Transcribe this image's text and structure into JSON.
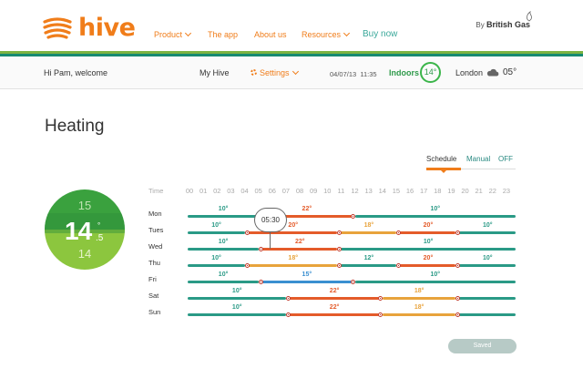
{
  "nav": {
    "brand": "hive",
    "links": [
      {
        "label": "Product",
        "has_caret": true
      },
      {
        "label": "The app",
        "has_caret": false
      },
      {
        "label": "About us",
        "has_caret": false
      },
      {
        "label": "Resources",
        "has_caret": true
      },
      {
        "label": "Buy now",
        "has_caret": false
      }
    ],
    "partner_prefix": "By",
    "partner": "British Gas"
  },
  "status": {
    "welcome": "Hi Pam, welcome",
    "my_hive": "My Hive",
    "settings": "Settings",
    "date": "04/07/13",
    "time": "11:35",
    "indoors_label": "Indoors",
    "indoors_temp": "14°",
    "city": "London",
    "outdoor_temp": "05°"
  },
  "page": {
    "title": "Heating"
  },
  "modes": {
    "schedule": "Schedule",
    "manual": "Manual",
    "off": "OFF",
    "active": "Schedule"
  },
  "dial": {
    "current": "14",
    "decimal": ".5",
    "degree": "°",
    "up": "15",
    "down": "14"
  },
  "schedule": {
    "time_label": "Time",
    "hours": [
      "00",
      "01",
      "02",
      "03",
      "04",
      "05",
      "06",
      "07",
      "08",
      "09",
      "10",
      "11",
      "12",
      "13",
      "14",
      "15",
      "16",
      "17",
      "18",
      "19",
      "20",
      "21",
      "22",
      "23"
    ],
    "selected_time": "05:30",
    "save_label": "Saved",
    "colors": {
      "cold": "#2a9a86",
      "warm": "#e8a33c",
      "hot": "#e45b2a",
      "cool": "#3a8fd0"
    },
    "days": [
      {
        "name": "Mon",
        "segments": [
          {
            "from": 0,
            "to": 5.5,
            "temp": "10°",
            "level": "cold"
          },
          {
            "from": 5.5,
            "to": 12.2,
            "temp": "22°",
            "level": "hot"
          },
          {
            "from": 12.2,
            "to": 24,
            "temp": "10°",
            "level": "cold"
          }
        ]
      },
      {
        "name": "Tues",
        "segments": [
          {
            "from": 0,
            "to": 4.5,
            "temp": "10°",
            "level": "cold"
          },
          {
            "from": 4.5,
            "to": 11.2,
            "temp": "20°",
            "level": "hot"
          },
          {
            "from": 11.2,
            "to": 15.5,
            "temp": "18°",
            "level": "warm"
          },
          {
            "from": 15.5,
            "to": 19.8,
            "temp": "20°",
            "level": "hot"
          },
          {
            "from": 19.8,
            "to": 24,
            "temp": "10°",
            "level": "cold"
          }
        ]
      },
      {
        "name": "Wed",
        "segments": [
          {
            "from": 0,
            "to": 5.5,
            "temp": "10°",
            "level": "cold"
          },
          {
            "from": 5.5,
            "to": 11.2,
            "temp": "22°",
            "level": "hot"
          },
          {
            "from": 11.2,
            "to": 24,
            "temp": "10°",
            "level": "cold"
          }
        ]
      },
      {
        "name": "Thu",
        "segments": [
          {
            "from": 0,
            "to": 4.5,
            "temp": "10°",
            "level": "cold"
          },
          {
            "from": 4.5,
            "to": 11.2,
            "temp": "18°",
            "level": "warm"
          },
          {
            "from": 11.2,
            "to": 15.5,
            "temp": "12°",
            "level": "cold"
          },
          {
            "from": 15.5,
            "to": 19.8,
            "temp": "20°",
            "level": "hot"
          },
          {
            "from": 19.8,
            "to": 24,
            "temp": "10°",
            "level": "cold"
          }
        ]
      },
      {
        "name": "Fri",
        "segments": [
          {
            "from": 0,
            "to": 5.5,
            "temp": "10°",
            "level": "cold"
          },
          {
            "from": 5.5,
            "to": 12.2,
            "temp": "15°",
            "level": "cool"
          },
          {
            "from": 12.2,
            "to": 24,
            "temp": "10°",
            "level": "cold"
          }
        ]
      },
      {
        "name": "Sat",
        "segments": [
          {
            "from": 0,
            "to": 7.5,
            "temp": "10°",
            "level": "cold"
          },
          {
            "from": 7.5,
            "to": 14.2,
            "temp": "22°",
            "level": "hot"
          },
          {
            "from": 14.2,
            "to": 19.8,
            "temp": "18°",
            "level": "warm"
          },
          {
            "from": 19.8,
            "to": 24,
            "temp": "",
            "level": "cold"
          }
        ]
      },
      {
        "name": "Sun",
        "segments": [
          {
            "from": 0,
            "to": 7.5,
            "temp": "10°",
            "level": "cold"
          },
          {
            "from": 7.5,
            "to": 14.2,
            "temp": "22°",
            "level": "hot"
          },
          {
            "from": 14.2,
            "to": 19.8,
            "temp": "18°",
            "level": "warm"
          },
          {
            "from": 19.8,
            "to": 24,
            "temp": "",
            "level": "cold"
          }
        ]
      }
    ]
  }
}
